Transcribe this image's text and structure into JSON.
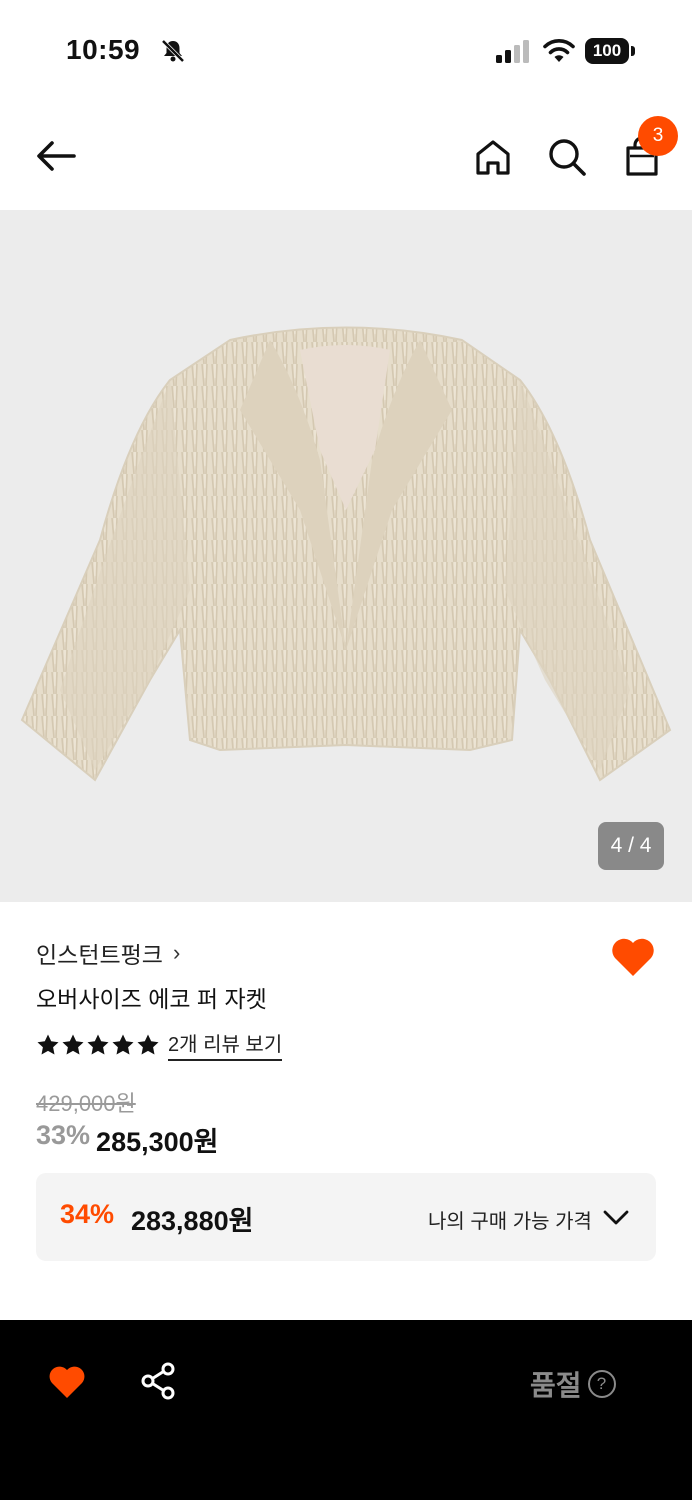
{
  "status_bar": {
    "time": "10:59",
    "battery": "100"
  },
  "header": {
    "cart_count": "3"
  },
  "gallery": {
    "counter": "4 / 4"
  },
  "product": {
    "brand": "인스턴트펑크",
    "name": "오버사이즈 에코 퍼 자켓",
    "rating_stars": 5,
    "review_link": "2개 리뷰 보기",
    "original_price": "429,000원",
    "discount_pct": "33%",
    "sale_price": "285,300원",
    "is_favorite": true
  },
  "benefit": {
    "discount_pct": "34%",
    "price": "283,880원",
    "label": "나의 구매 가능 가격"
  },
  "bottom_bar": {
    "status": "품절",
    "help": "?"
  },
  "colors": {
    "accent": "#ff4b00",
    "bottom_bar_bg": "#000000",
    "gallery_bg": "#ececec"
  }
}
